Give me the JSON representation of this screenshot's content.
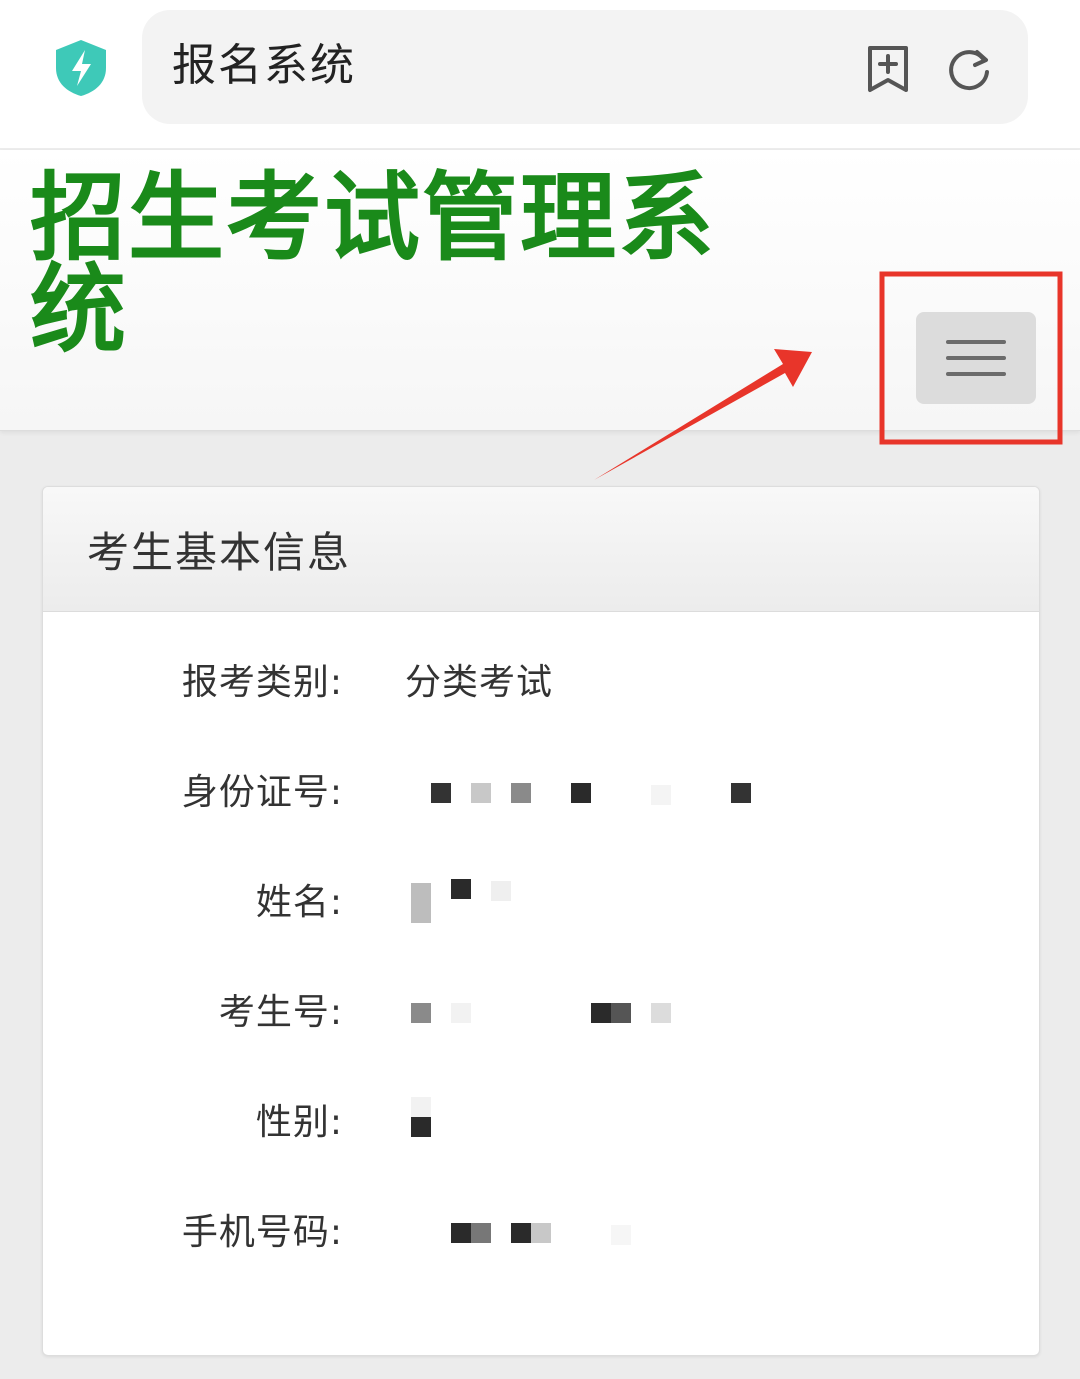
{
  "browser": {
    "address_text": "报名系统",
    "icons": [
      "shield-bolt-icon",
      "bookmark-add-icon",
      "reload-icon"
    ],
    "shield_color": "#3ec9b8"
  },
  "site": {
    "title": "招生考试管理系统",
    "title_color": "#1a8a1a",
    "menu_icon": "hamburger-menu-icon"
  },
  "annotation": {
    "color": "#e8352a"
  },
  "panel": {
    "title": "考生基本信息",
    "fields": [
      {
        "label": "报考类别:",
        "value": "分类考试"
      },
      {
        "label": "身份证号:",
        "value": ""
      },
      {
        "label": "姓名:",
        "value": ""
      },
      {
        "label": "考生号:",
        "value": ""
      },
      {
        "label": "性别:",
        "value": ""
      },
      {
        "label": "手机号码:",
        "value": ""
      }
    ]
  }
}
